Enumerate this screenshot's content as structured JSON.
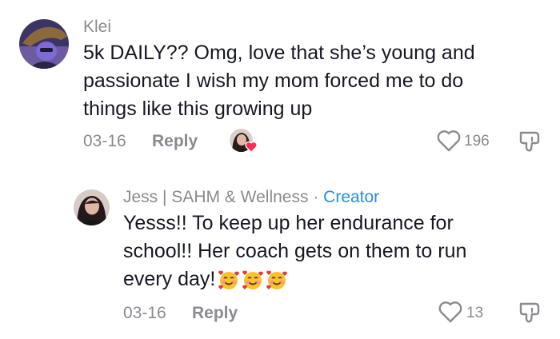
{
  "comment": {
    "username": "Klei",
    "text_lines": [
      "5k DAILY?? Omg, love that she’s young and",
      "passionate I wish my mom forced me to do",
      "things like this growing up"
    ],
    "date": "03-16",
    "reply_label": "Reply",
    "like_count": "196"
  },
  "reply": {
    "username": "Jess | SAHM & Wellness",
    "separator": "·",
    "badge": "Creator",
    "text_lines": [
      "Yesss!! To keep up her endurance for",
      "school!! Her coach gets on them to run",
      "every day!"
    ],
    "date": "03-16",
    "reply_label": "Reply",
    "like_count": "13"
  },
  "colors": {
    "muted": "#8a8b91",
    "creator": "#2b8fd6",
    "heart": "#fe2c55"
  },
  "icons": [
    "user-avatar-icon",
    "creator-liked-heart-icon",
    "heart-outline-icon",
    "dislike-icon",
    "smiling-face-with-hearts-emoji"
  ]
}
